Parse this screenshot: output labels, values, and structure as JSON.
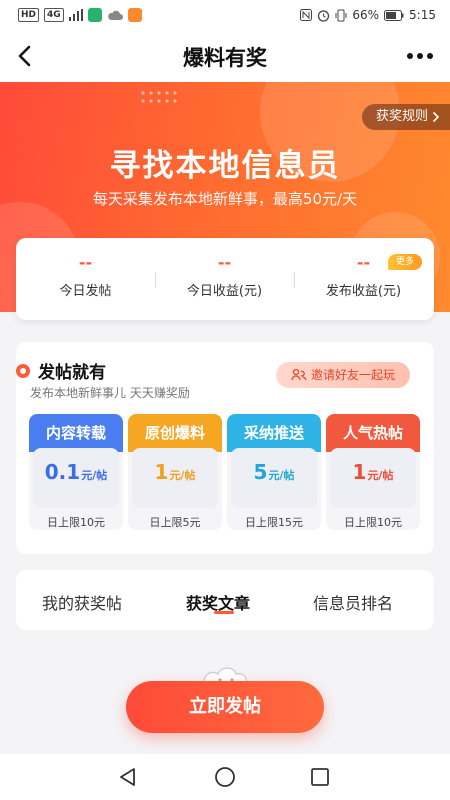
{
  "status_bar": {
    "left_chips": [
      "HD",
      "4G"
    ],
    "right_text": "N ⏰ ▯ 66%",
    "battery": "66%",
    "time": "5:15",
    "app_colors": [
      "#27b36a",
      "#888888",
      "#ff8a2e"
    ]
  },
  "nav": {
    "title": "爆料有奖",
    "back_icon": "back-arrow-icon",
    "more_icon": "more-dots-icon"
  },
  "hero": {
    "rules_label": "获奖规则",
    "title": "寻找本地信息员",
    "subtitle": "每天采集发布本地新鲜事，最高50元/天"
  },
  "stats": [
    {
      "value": "--",
      "label": "今日发帖"
    },
    {
      "value": "--",
      "label": "今日收益(元)"
    },
    {
      "value": "--",
      "label": "发布收益(元)"
    }
  ],
  "stats_badge": "更多",
  "post_section": {
    "title": "发帖就有",
    "subtitle": "发布本地新鲜事儿 天天赚奖励",
    "invite_label": "邀请好友一起玩",
    "tiers": [
      {
        "name": "内容转载",
        "amount": "0.1",
        "unit": "元/帖",
        "limit": "日上限10元",
        "color": "#4a7ef0"
      },
      {
        "name": "原创爆料",
        "amount": "1",
        "unit": "元/帖",
        "limit": "日上限5元",
        "color": "#f5a623"
      },
      {
        "name": "采纳推送",
        "amount": "5",
        "unit": "元/帖",
        "limit": "日上限15元",
        "color": "#2fb3e6"
      },
      {
        "name": "人气热帖",
        "amount": "1",
        "unit": "元/帖",
        "limit": "日上限10元",
        "color": "#f2583e"
      }
    ]
  },
  "tabs": [
    {
      "label": "我的获奖帖",
      "active": false
    },
    {
      "label": "获奖文章",
      "active": true
    },
    {
      "label": "信息员排名",
      "active": false
    }
  ],
  "cta_label": "立即发帖",
  "colors": {
    "accent": "#ff5a3c",
    "hero_start": "#ff4a3a",
    "hero_end": "#ff8a2e"
  }
}
